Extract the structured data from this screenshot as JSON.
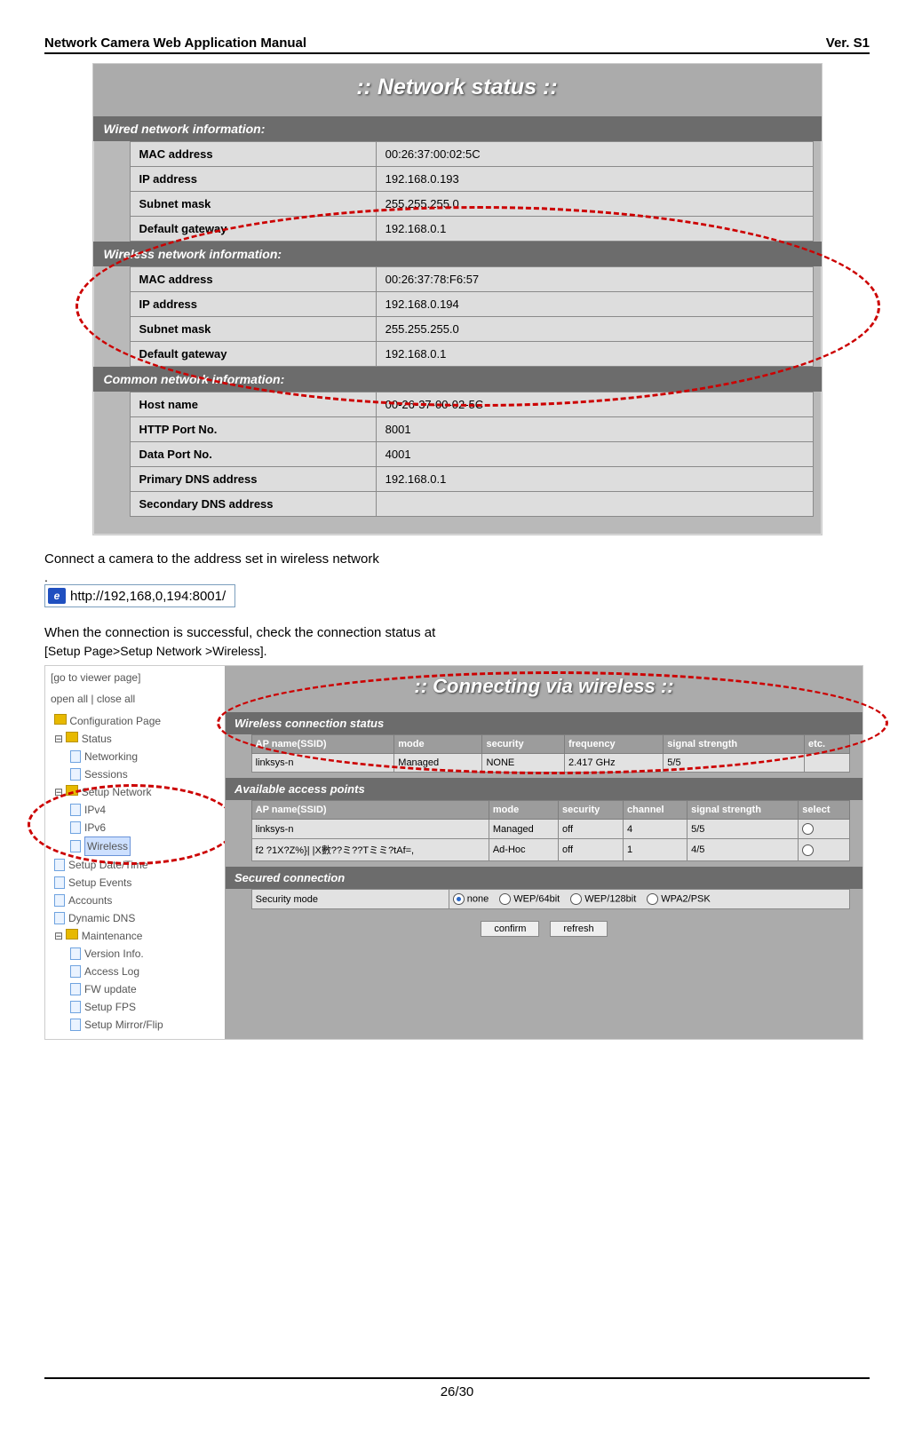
{
  "doc": {
    "title_left": "Network Camera Web Application Manual",
    "title_right": "Ver. S1",
    "page": "26/30",
    "body_txt1": "Connect a camera to the address set in wireless network",
    "body_txt2": ".",
    "body_txt3": "When the connection is successful, check the connection status at",
    "body_txt4": "[Setup Page>Setup Network >Wireless]."
  },
  "addressbar": {
    "url": "http://192,168,0,194:8001/"
  },
  "networkStatus": {
    "title": ":: Network status ::",
    "wired": {
      "hdr": "Wired network information:",
      "rows": [
        {
          "l": "MAC address",
          "v": "00:26:37:00:02:5C"
        },
        {
          "l": "IP address",
          "v": "192.168.0.193"
        },
        {
          "l": "Subnet mask",
          "v": "255.255.255.0"
        },
        {
          "l": "Default gateway",
          "v": "192.168.0.1"
        }
      ]
    },
    "wireless": {
      "hdr": "Wireless network information:",
      "rows": [
        {
          "l": "MAC address",
          "v": "00:26:37:78:F6:57"
        },
        {
          "l": "IP address",
          "v": "192.168.0.194"
        },
        {
          "l": "Subnet mask",
          "v": "255.255.255.0"
        },
        {
          "l": "Default gateway",
          "v": "192.168.0.1"
        }
      ]
    },
    "common": {
      "hdr": "Common network information:",
      "rows": [
        {
          "l": "Host name",
          "v": "00-26-37-00-02-5C"
        },
        {
          "l": "HTTP Port No.",
          "v": "8001"
        },
        {
          "l": "Data Port No.",
          "v": "4001"
        },
        {
          "l": "Primary DNS address",
          "v": "192.168.0.1"
        },
        {
          "l": "Secondary DNS address",
          "v": ""
        }
      ]
    }
  },
  "sidebar": {
    "goto": "[go to viewer page]",
    "openclose": "open all | close all",
    "root": "Configuration Page",
    "status": {
      "label": "Status",
      "children": [
        "Networking",
        "Sessions"
      ]
    },
    "setupNetwork": {
      "label": "Setup Network",
      "children": [
        "IPv4",
        "IPv6",
        "Wireless"
      ]
    },
    "others": [
      "Setup Date/Time",
      "Setup Events",
      "Accounts",
      "Dynamic DNS"
    ],
    "maint": {
      "label": "Maintenance",
      "children": [
        "Version Info.",
        "Access Log",
        "FW update",
        "Setup FPS",
        "Setup Mirror/Flip"
      ]
    }
  },
  "wirelessPage": {
    "title": ":: Connecting via wireless ::",
    "connStatus": {
      "hdr": "Wireless connection status",
      "cols": [
        "AP name(SSID)",
        "mode",
        "security",
        "frequency",
        "signal strength",
        "etc."
      ],
      "row": [
        "linksys-n",
        "Managed",
        "NONE",
        "2.417 GHz",
        "5/5",
        ""
      ]
    },
    "aps": {
      "hdr": "Available access points",
      "cols": [
        "AP name(SSID)",
        "mode",
        "security",
        "channel",
        "signal strength",
        "select"
      ],
      "rows": [
        [
          "linksys-n",
          "Managed",
          "off",
          "4",
          "5/5",
          ""
        ],
        [
          "f2 ?1X?Z%}| |X數??ミ??Tミミ?tAf=,",
          "Ad-Hoc",
          "off",
          "1",
          "4/5",
          ""
        ]
      ]
    },
    "secured": {
      "hdr": "Secured connection",
      "label": "Security mode",
      "opts": [
        "none",
        "WEP/64bit",
        "WEP/128bit",
        "WPA2/PSK"
      ]
    },
    "confirm": "confirm",
    "refresh": "refresh"
  }
}
